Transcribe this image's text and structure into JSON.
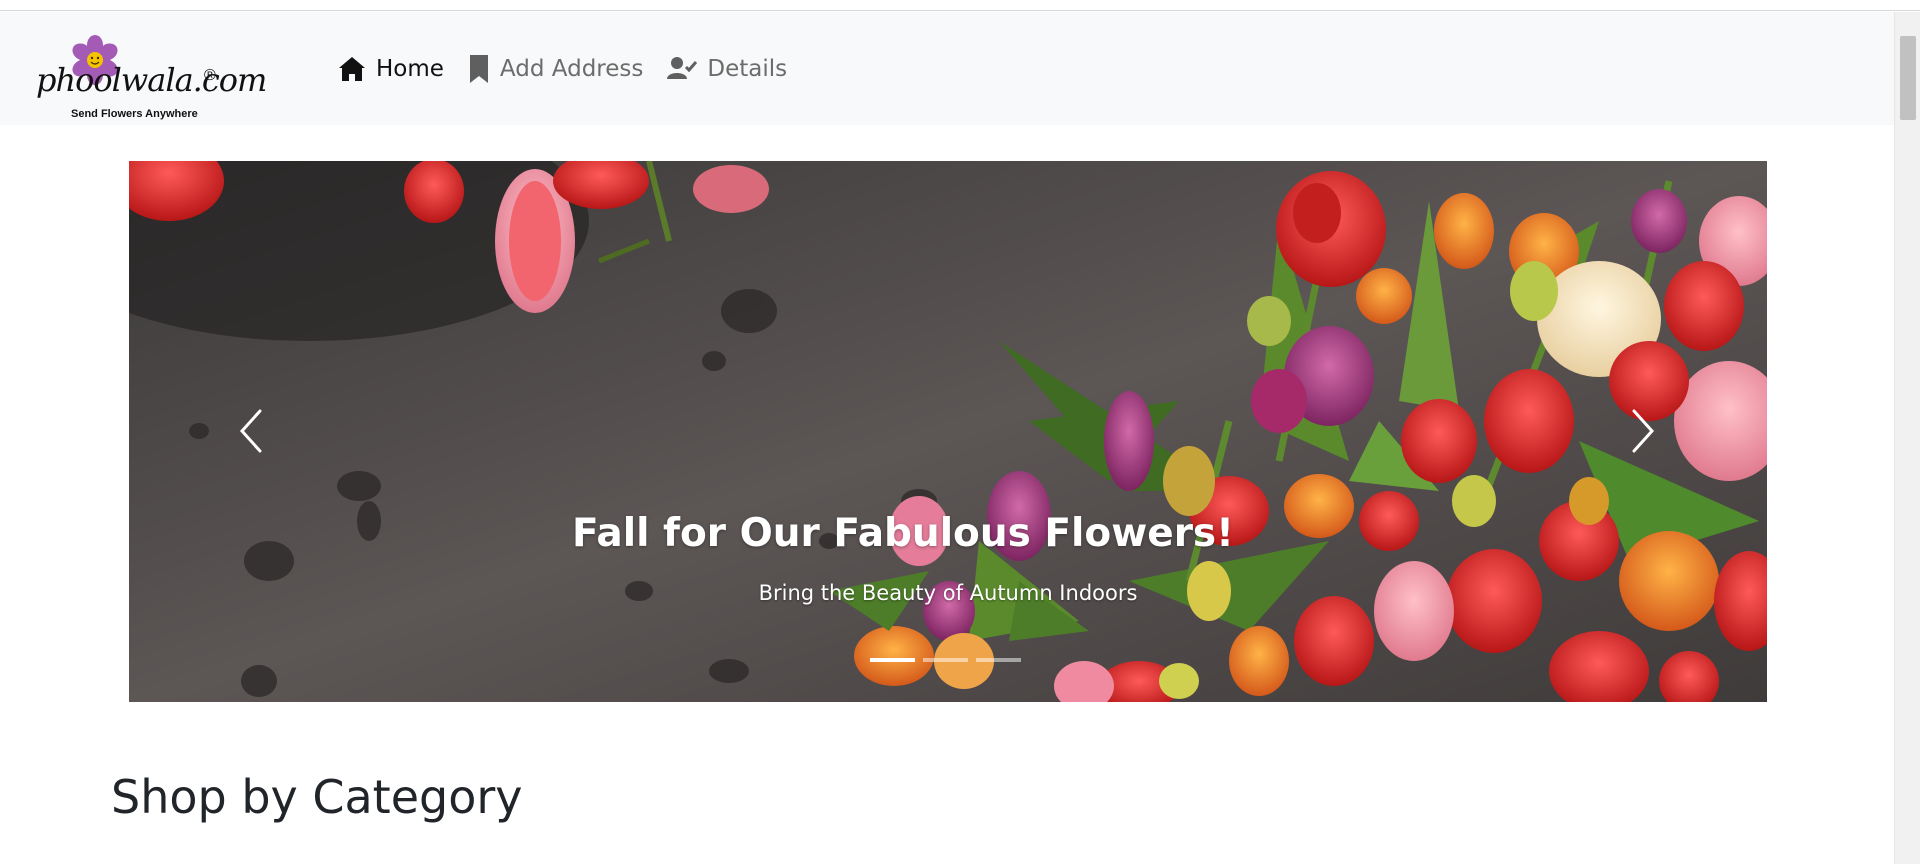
{
  "navbar": {
    "brand": {
      "wordmark": "phoolwala.com",
      "registered_mark": "®",
      "tagline": "Send Flowers Anywhere"
    },
    "links": [
      {
        "label": "Home",
        "icon": "home-icon",
        "active": true
      },
      {
        "label": "Add Address",
        "icon": "bookmark-icon",
        "active": false
      },
      {
        "label": "Details",
        "icon": "user-check-icon",
        "active": false
      }
    ]
  },
  "carousel": {
    "caption_title": "Fall for Our Fabulous Flowers!",
    "caption_text": "Bring the Beauty of Autumn Indoors",
    "slide_count": 3,
    "active_slide": 1,
    "prev_icon": "chevron-left-icon",
    "next_icon": "chevron-right-icon"
  },
  "main": {
    "section_title": "Shop by Category"
  },
  "colors": {
    "navbar_bg": "#f8f9fa",
    "text_dark": "#212529",
    "nav_muted": "#6c6c6c",
    "logo_flower": "#a35bb5",
    "logo_center": "#f5c400"
  }
}
